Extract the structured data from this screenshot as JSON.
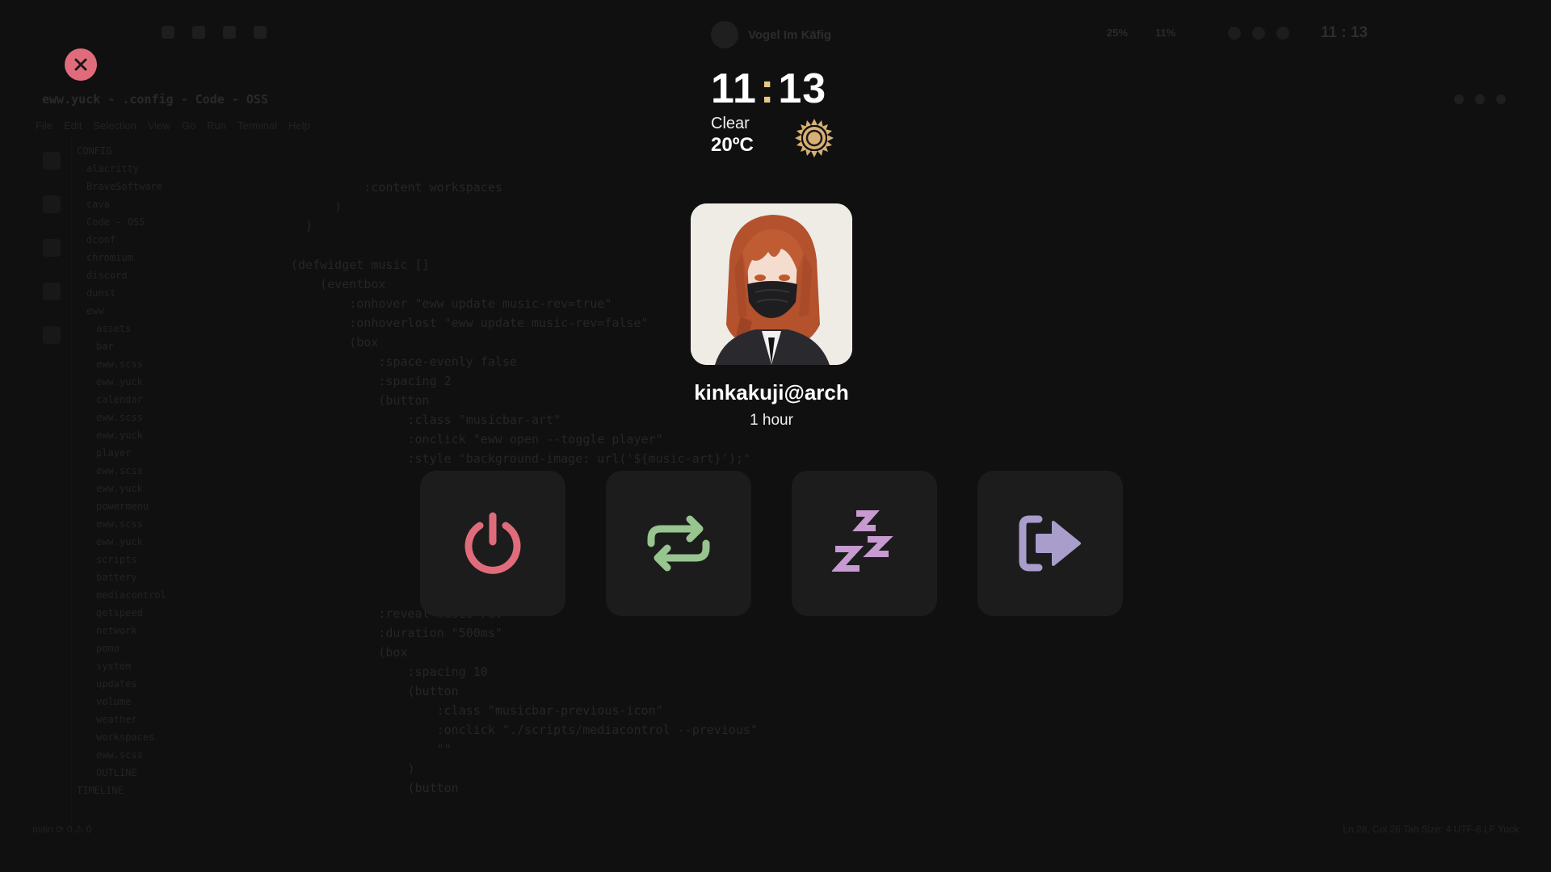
{
  "background": {
    "topbar": {
      "song_title": "Vogel Im Käfig",
      "stats": [
        "25%",
        "11%"
      ],
      "clock": "11 : 13"
    },
    "editor": {
      "title": "eww.yuck - .config - Code - OSS",
      "menu": [
        "File",
        "Edit",
        "Selection",
        "View",
        "Go",
        "Run",
        "Terminal",
        "Help"
      ],
      "tree": [
        "CONFIG",
        "alacritty",
        "BraveSoftware",
        "cava",
        "Code - OSS",
        "dconf",
        "chromium",
        "discord",
        "dunst",
        "eww",
        "assets",
        "bar",
        "eww.scss",
        "eww.yuck",
        "calendar",
        "eww.scss",
        "eww.yuck",
        "player",
        "eww.scss",
        "eww.yuck",
        "powermenu",
        "eww.scss",
        "eww.yuck",
        "scripts",
        "battery",
        "mediacontrol",
        "getspeed",
        "network",
        "pomo",
        "system",
        "updates",
        "volume",
        "weather",
        "workspaces",
        "eww.scss",
        "OUTLINE",
        "TIMELINE"
      ],
      "code_lines": [
        "          :content workspaces",
        "      )",
        "  )",
        "",
        "(defwidget music []",
        "    (eventbox",
        "        :onhover \"eww update music-rev=true\"",
        "        :onhoverlost \"eww update music-rev=false\"",
        "        (box",
        "            :space-evenly false",
        "            :spacing 2",
        "            (button",
        "                :class \"musicbar-art\"",
        "                :onclick \"eww open --toggle player\"",
        "                :style \"background-image: url('${music-art}');\"",
        "",
        "",
        "",
        "",
        "",
        "",
        "",
        "            :reveal music-rev",
        "            :duration \"500ms\"",
        "            (box",
        "                :spacing 10",
        "                (button",
        "                    :class \"musicbar-previous-icon\"",
        "                    :onclick \"./scripts/mediacontrol --previous\"",
        "                    \"\"",
        "                )",
        "                (button"
      ],
      "status_left": "main  ⟳ 0 ⚠ 0",
      "status_right": "Ln 28, Col 26   Tab Size: 4   UTF-8   LF   Yuck"
    }
  },
  "overlay": {
    "close_icon": "close-icon",
    "clock": {
      "hours": "11",
      "separator": ":",
      "minutes": "13"
    },
    "weather": {
      "condition": "Clear",
      "temperature": "20ºC",
      "icon": "sun-icon"
    },
    "profile": {
      "avatar": "avatar-image",
      "username": "kinkakuji@arch",
      "uptime": "1 hour"
    },
    "actions": [
      {
        "name": "shutdown",
        "icon": "power-icon",
        "color": "#e06c7b"
      },
      {
        "name": "reboot",
        "icon": "repeat-icon",
        "color": "#98c48f"
      },
      {
        "name": "suspend",
        "icon": "sleep-icon",
        "color": "#c79ad0"
      },
      {
        "name": "logout",
        "icon": "logout-icon",
        "color": "#a99dcc"
      }
    ],
    "colors": {
      "accent_clock_colon": "#e8c887",
      "sun": "#d8b075",
      "close_button": "#e06c7b",
      "button_bg": "#1c1c1c"
    }
  }
}
